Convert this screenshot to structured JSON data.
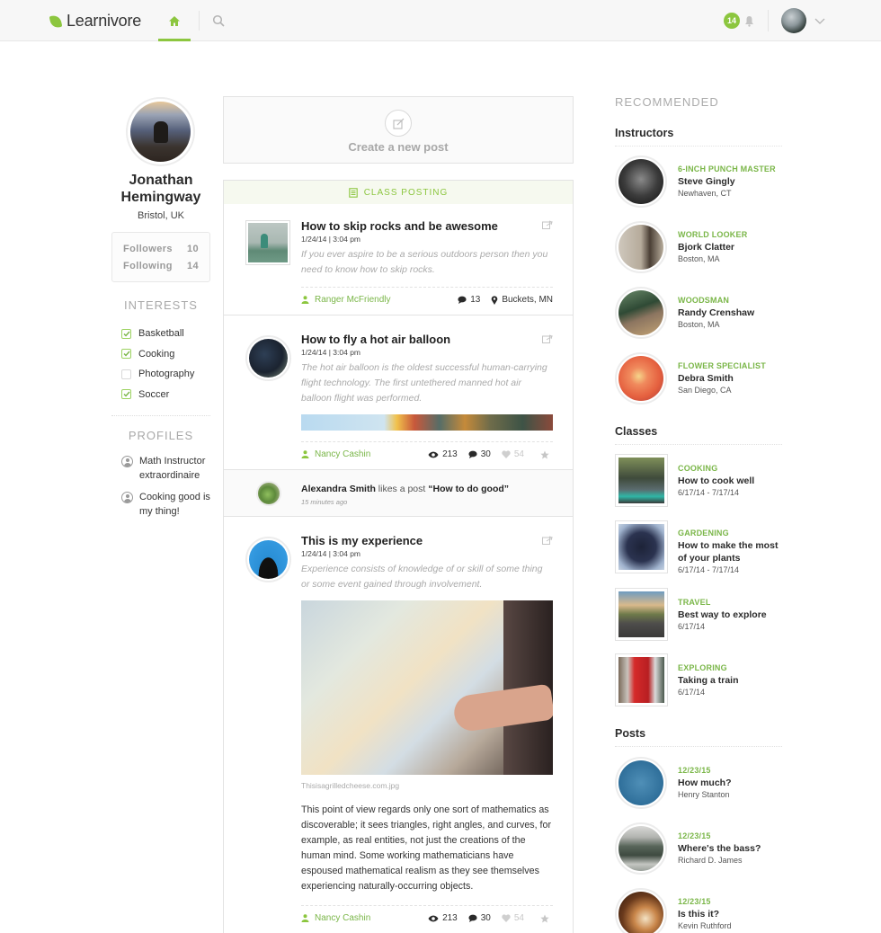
{
  "header": {
    "brand": "Learnivore",
    "brand_color": "#8cc63f",
    "nav": [
      {
        "name": "home",
        "icon": "home-icon",
        "active": true
      },
      {
        "name": "search",
        "icon": "search-icon",
        "active": false
      }
    ],
    "notification_count": "14",
    "bell_icon": "bell-icon",
    "user_menu_icon": "chevron-down-icon"
  },
  "profile": {
    "name": "Jonathan Hemingway",
    "location": "Bristol, UK",
    "followers_label": "Followers",
    "followers_count": "10",
    "following_label": "Following",
    "following_count": "14",
    "interests_title": "INTERESTS",
    "interests": [
      {
        "label": "Basketball",
        "checked": true
      },
      {
        "label": "Cooking",
        "checked": true
      },
      {
        "label": "Photography",
        "checked": false
      },
      {
        "label": "Soccer",
        "checked": true
      }
    ],
    "profiles_title": "PROFILES",
    "profiles": [
      {
        "label": "Math Instructor extraordinaire"
      },
      {
        "label": "Cooking good is my thing!"
      }
    ]
  },
  "feed": {
    "create_post_label": "Create a new post",
    "class_posting_label": "CLASS POSTING",
    "posts": [
      {
        "title": "How to skip rocks and be awesome",
        "date": "1/24/14  |  3:04 pm",
        "excerpt": "If you ever aspire to be a serious outdoors person then you need to know how to skip rocks.",
        "author": "Ranger McFriendly",
        "comments": "13",
        "location": "Buckets, MN"
      },
      {
        "title": "How to fly a hot air balloon",
        "date": "1/24/14  |  3:04 pm",
        "excerpt": "The hot air balloon is the oldest successful human-carrying flight technology. The first untethered manned hot air balloon flight was performed.",
        "author": "Nancy Cashin",
        "views": "213",
        "comments": "30",
        "likes": "54"
      },
      {
        "title": "This is my experience",
        "date": "1/24/14  |  3:04 pm",
        "excerpt": "Experience consists of knowledge of or skill of some thing or some event gained through involvement.",
        "image_caption": "Thisisagrilledcheese.com.jpg",
        "body": "This point of view regards only one sort of mathematics as discoverable; it sees triangles, right angles, and curves, for example, as real entities, not just the creations of the human mind. Some working mathematicians have espoused mathematical realism as they see themselves experiencing naturally-occurring objects.",
        "author": "Nancy Cashin",
        "views": "213",
        "comments": "30",
        "likes": "54"
      }
    ],
    "activity": {
      "user": "Alexandra Smith",
      "action": " likes a post ",
      "target": "“How to do good”",
      "time": "15 minutes ago"
    }
  },
  "recommended": {
    "title": "RECOMMENDED",
    "instructors_title": "Instructors",
    "instructors": [
      {
        "tag": "6-INCH PUNCH MASTER",
        "name": "Steve Gingly",
        "location": "Newhaven, CT"
      },
      {
        "tag": "WORLD LOOKER",
        "name": "Bjork Clatter",
        "location": "Boston, MA"
      },
      {
        "tag": "WOODSMAN",
        "name": "Randy Crenshaw",
        "location": "Boston, MA"
      },
      {
        "tag": "FLOWER SPECIALIST",
        "name": "Debra Smith",
        "location": "San Diego, CA"
      }
    ],
    "classes_title": "Classes",
    "classes": [
      {
        "category": "COOKING",
        "title": "How to cook well",
        "dates": "6/17/14 - 7/17/14"
      },
      {
        "category": "GARDENING",
        "title": "How to make the most of your plants",
        "dates": "6/17/14 - 7/17/14"
      },
      {
        "category": "TRAVEL",
        "title": "Best way to explore",
        "dates": "6/17/14"
      },
      {
        "category": "EXPLORING",
        "title": "Taking a train",
        "dates": "6/17/14"
      }
    ],
    "posts_title": "Posts",
    "posts": [
      {
        "date": "12/23/15",
        "title": "How much?",
        "author": "Henry Stanton"
      },
      {
        "date": "12/23/15",
        "title": "Where's the bass?",
        "author": "Richard D. James"
      },
      {
        "date": "12/23/15",
        "title": "Is this it?",
        "author": "Kevin Ruthford"
      }
    ]
  }
}
